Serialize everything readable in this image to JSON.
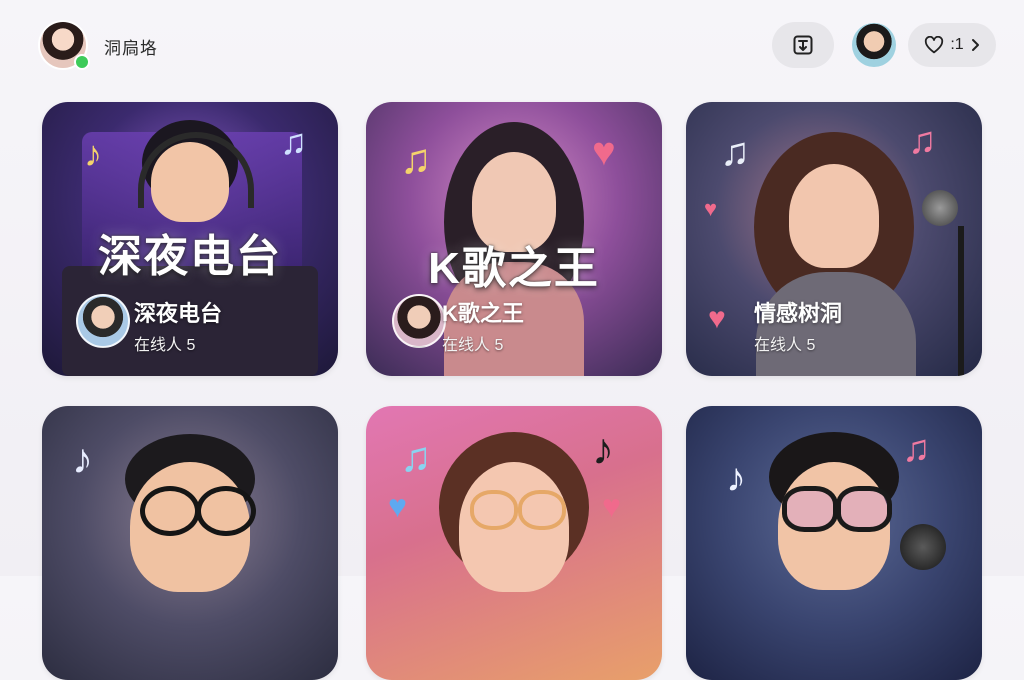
{
  "header": {
    "username": "洞扃垎",
    "like_count": ":1",
    "icons": {
      "share": "share-box-icon",
      "heart": "heart-outline-icon",
      "chevron": "chevron-right-icon"
    }
  },
  "rooms": [
    {
      "big_title": "深夜电台",
      "name": "深夜电台",
      "online": "在线人 5"
    },
    {
      "big_title": "K歌之王",
      "name": "K歌之王",
      "online": "在线人 5"
    },
    {
      "big_title": "",
      "name": "情感树洞",
      "online": "在线人 5"
    },
    {
      "big_title": "",
      "name": "",
      "online": ""
    },
    {
      "big_title": "",
      "name": "",
      "online": ""
    },
    {
      "big_title": "",
      "name": "",
      "online": ""
    }
  ],
  "colors": {
    "background": "#f3f2f6",
    "pill": "#e7e6ea",
    "online_dot": "#3ecb5a",
    "heart": "#f06a8c",
    "note_yellow": "#f4d36b"
  }
}
